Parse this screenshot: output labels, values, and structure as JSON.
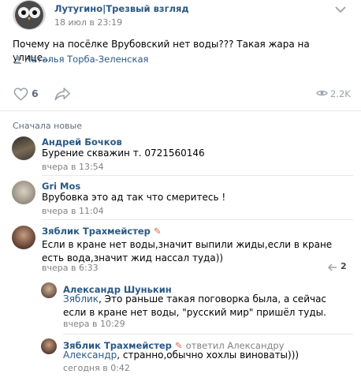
{
  "post": {
    "author": "Лутугино|Трезвый взгляд",
    "date": "18 июл в 23:19",
    "text": "Почему на посёлке Врубовский нет воды??? Такая жара на улице...",
    "signer": "Наталья Торба-Зеленская",
    "likes": "6",
    "views": "2.2K"
  },
  "comments_header": "Сначала новые",
  "comments": [
    {
      "author": "Андрей Бочков",
      "text": "Бурение скважин т. 0721560146",
      "date": "вчера в 13:54"
    },
    {
      "author": "Gri Mos",
      "text": "Врубовка это ад так что смеритесь !",
      "date": "вчера в 11:04"
    },
    {
      "author": "Зяблик Трахмейстер",
      "text": "Если в кране нет воды,значит выпили жиды,если в кране есть вода,значит жид нассал туда))",
      "date": "вчера в 6:33",
      "replies_count": "2"
    }
  ],
  "replies": [
    {
      "author": "Александр Шунькин",
      "mention": "Зяблик",
      "text": ", Это раньше такая поговорка была, а сейчас если в кране нет воды, \"русский мир\" пришёл туды.",
      "date": "вчера в 10:29"
    },
    {
      "author": "Зяблик Трахмейстер",
      "replied_to": "ответил Александру",
      "mention": "Александр",
      "text": ", странно,обычно хохлы виноваты)))",
      "date": "сегодня в 0:42"
    }
  ],
  "colors": {
    "link": "#2a5885",
    "meta": "#828282",
    "icon": "#99a2ad"
  }
}
